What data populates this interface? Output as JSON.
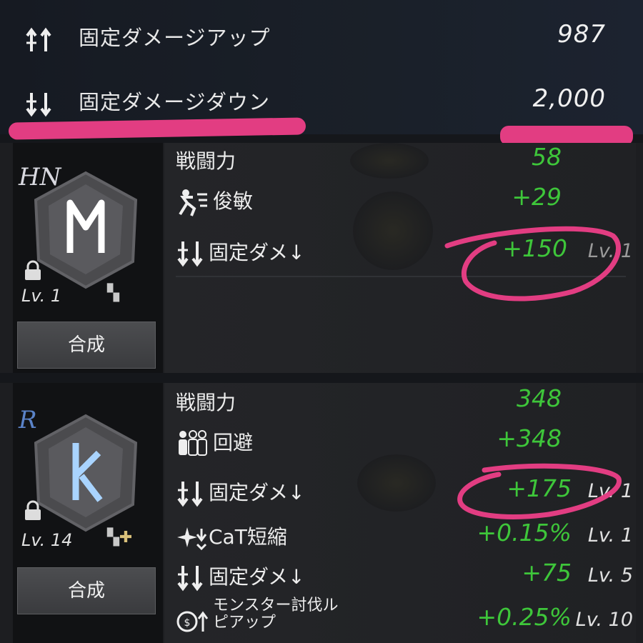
{
  "top_stats": [
    {
      "icon": "arrows-up-icon",
      "label": "固定ダメージアップ",
      "value": "987"
    },
    {
      "icon": "arrows-down-icon",
      "label": "固定ダメージダウン",
      "value": "2,000"
    }
  ],
  "cards": [
    {
      "rank": "HN",
      "rank_color": "#d9d9e0",
      "rune_glyph": "M",
      "level": "Lv. 1",
      "synth_button": "合成",
      "stats": [
        {
          "label": "戦闘力",
          "value": "58",
          "lv": ""
        },
        {
          "icon": "agility-icon",
          "label": "俊敏",
          "value": "+29",
          "lv": ""
        },
        {
          "icon": "arrows-down-icon",
          "label": "固定ダメ↓",
          "value": "+150",
          "lv": "Lv. 1"
        }
      ]
    },
    {
      "rank": "R",
      "rank_color": "#5b83c8",
      "rune_glyph": "K",
      "level": "Lv. 14",
      "synth_button": "合成",
      "stats": [
        {
          "label": "戦闘力",
          "value": "348",
          "lv": ""
        },
        {
          "icon": "evasion-icon",
          "label": "回避",
          "value": "+348",
          "lv": ""
        },
        {
          "icon": "arrows-down-icon",
          "label": "固定ダメ↓",
          "value": "+175",
          "lv": "Lv. 1"
        },
        {
          "icon": "cast-time-icon",
          "label": "CaT短縮",
          "value": "+0.15%",
          "lv": "Lv. 1"
        },
        {
          "icon": "arrows-down-icon",
          "label": "固定ダメ↓",
          "value": "+75",
          "lv": "Lv. 5"
        },
        {
          "icon": "monster-drop-icon",
          "label_line1": "モンスター討伐ル",
          "label_line2": "ピアップ",
          "value": "+0.25%",
          "lv": "Lv. 10"
        }
      ]
    }
  ],
  "colors": {
    "accent_marker": "#e23d82",
    "stat_green": "#3ec63a"
  }
}
